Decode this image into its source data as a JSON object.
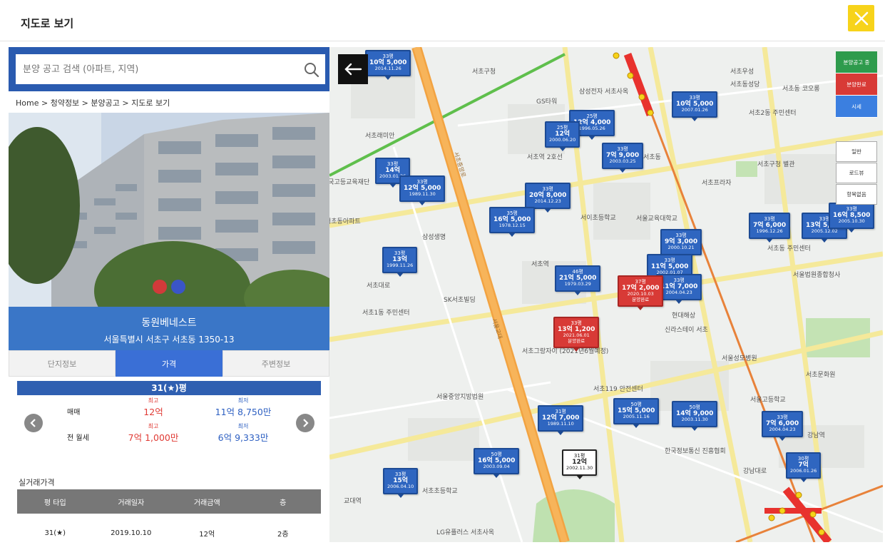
{
  "header": {
    "title": "지도로 보기",
    "close_icon": "close-icon"
  },
  "search": {
    "placeholder": "분양 공고 검색 (아파트, 지역)"
  },
  "breadcrumb": [
    "Home >",
    " 청약정보 >",
    " 분양공고 >",
    " 지도로 보기"
  ],
  "apartment": {
    "name": "동원베네스트",
    "address": "서울특별시 서초구 서초동 1350-13"
  },
  "tabs": [
    "단지정보",
    "가격",
    "주변정보"
  ],
  "price": {
    "type": "31(★)평",
    "rows": [
      {
        "label": "매매",
        "high_label": "최고",
        "high": "12억",
        "low_label": "최저",
        "low": "11억 8,750만"
      },
      {
        "label": "전 월세",
        "high_label": "최고",
        "high": "7억 1,000만",
        "low_label": "최저",
        "low": "6억 9,333만"
      }
    ]
  },
  "real_trade": {
    "title": "실거래가격",
    "columns": [
      "평 타입",
      "거래일자",
      "거래금액",
      "층"
    ],
    "rows": [
      [
        "31(★)",
        "2019.10.10",
        "12억",
        "2층"
      ]
    ]
  },
  "map_controls": [
    "분양공고 중",
    "분양완료",
    "시세",
    "일반",
    "로드뷰",
    "항목없음"
  ],
  "map_labels": [
    "서초구청",
    "서울교대",
    "서초동",
    "서초역",
    "교대역",
    "서초중앙로",
    "서초1동 주민센터",
    "서초그랑자이 (2021년6월예정)",
    "SK서초빌딩",
    "서초초등학교",
    "서울고등학교",
    "서초프라자",
    "한국정보통신 진흥협회",
    "서초동 주민센터",
    "현대해상",
    "신라스테이 서초",
    "서초119 안전센터",
    "서울법원종합청사",
    "서울성모병원",
    "강남역",
    "서이초등학교",
    "서울중앙지방법원",
    "LG유플러스 서초사옥",
    "서초대로",
    "강남대로",
    "서초2동 주민센터",
    "서초구청 별관",
    "서초동아파트",
    "서초래미안",
    "서초동성당",
    "서초우성",
    "서초동 코오롱",
    "삼성전자 서초사옥",
    "한국고등교육재단",
    "서초역 2호선",
    "서울교육대학교",
    "GS타워",
    "삼성생명",
    "서초문화원"
  ],
  "pins": [
    {
      "area": "33평",
      "price": "10억 5,000",
      "date": "2014.11.26",
      "color": "blue"
    },
    {
      "area": "33평",
      "price": "10억 5,000",
      "date": "2007.01.26",
      "color": "blue"
    },
    {
      "area": "25평",
      "price": "12억 4,000",
      "date": "1996.05.26",
      "color": "blue"
    },
    {
      "area": "25평",
      "price": "12억",
      "date": "2000.06.20",
      "color": "blue"
    },
    {
      "area": "33평",
      "price": "7억 9,000",
      "date": "2003.03.25",
      "color": "blue"
    },
    {
      "area": "33평",
      "price": "14억",
      "date": "2003.01.26",
      "color": "blue"
    },
    {
      "area": "33평",
      "price": "12억 5,000",
      "date": "1989.11.30",
      "color": "blue"
    },
    {
      "area": "33평",
      "price": "20억 8,000",
      "date": "2014.12.23",
      "color": "blue"
    },
    {
      "area": "35평",
      "price": "16억 5,000",
      "date": "1978.12.15",
      "color": "blue"
    },
    {
      "area": "33평",
      "price": "13억",
      "date": "1999.11.26",
      "color": "blue"
    },
    {
      "area": "46평",
      "price": "21억 5,000",
      "date": "1979.03.29",
      "color": "blue"
    },
    {
      "area": "33평",
      "price": "9억 3,000",
      "date": "2000.10.21",
      "color": "blue"
    },
    {
      "area": "33평",
      "price": "11억 5,000",
      "date": "2002.01.07",
      "color": "blue"
    },
    {
      "area": "33평",
      "price": "11억 7,000",
      "date": "2004.04.23",
      "color": "blue"
    },
    {
      "area": "37평",
      "price": "17억 2,000",
      "date": "2020.10.03",
      "status": "분양완료",
      "color": "red"
    },
    {
      "area": "33평",
      "price": "13억 1,200",
      "date": "2021.06.01",
      "status": "분양완료",
      "color": "red"
    },
    {
      "area": "33평",
      "price": "7억 6,000",
      "date": "1996.12.26",
      "color": "blue"
    },
    {
      "area": "33평",
      "price": "13억 5,000",
      "date": "2005.12.02",
      "color": "blue"
    },
    {
      "area": "33평",
      "price": "16억 8,500",
      "date": "2005.10.30",
      "color": "blue"
    },
    {
      "area": "31평",
      "price": "12억 7,000",
      "date": "1989.11.10",
      "color": "blue"
    },
    {
      "area": "50평",
      "price": "15억 5,000",
      "date": "2005.11.16",
      "color": "blue"
    },
    {
      "area": "50평",
      "price": "14억 9,000",
      "date": "2003.11.30",
      "color": "blue"
    },
    {
      "area": "33평",
      "price": "7억 6,000",
      "date": "2004.04.23",
      "color": "blue"
    },
    {
      "area": "31평",
      "price": "12억",
      "date": "2002.11.30",
      "color": "white"
    },
    {
      "area": "50평",
      "price": "16억 5,000",
      "date": "2003.09.04",
      "color": "blue"
    },
    {
      "area": "33평",
      "price": "15억",
      "date": "2006.04.10",
      "color": "blue"
    },
    {
      "area": "30평",
      "price": "7억",
      "date": "2006.01.26",
      "color": "blue"
    }
  ]
}
